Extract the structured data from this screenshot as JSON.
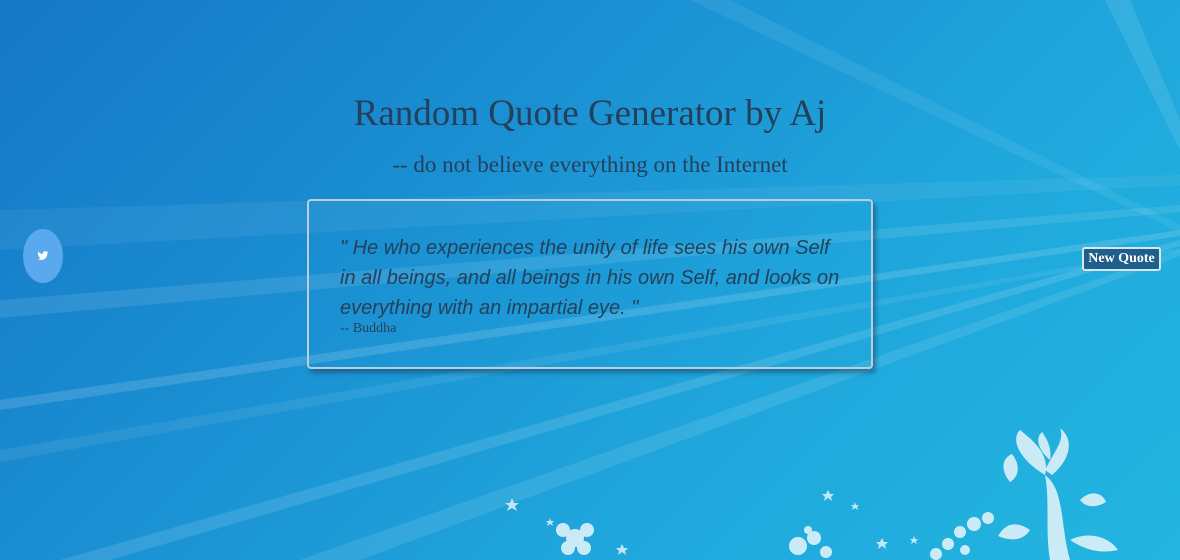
{
  "header": {
    "title": "Random Quote Generator by Aj",
    "subtitle": "-- do not believe everything on the Internet"
  },
  "quote": {
    "text": "\" He who experiences the unity of life sees his own Self in all beings, and all beings in his own Self, and looks on everything with an impartial eye. \"",
    "author": "-- Buddha"
  },
  "actions": {
    "tweet_icon": "twitter-bird-icon",
    "new_quote_label": "New Quote"
  },
  "colors": {
    "background_start": "#1577c6",
    "background_end": "#23b6e0",
    "text": "#25405a",
    "twitter_button": "#5aa9ef",
    "new_quote_button": "#1f5f8c"
  }
}
